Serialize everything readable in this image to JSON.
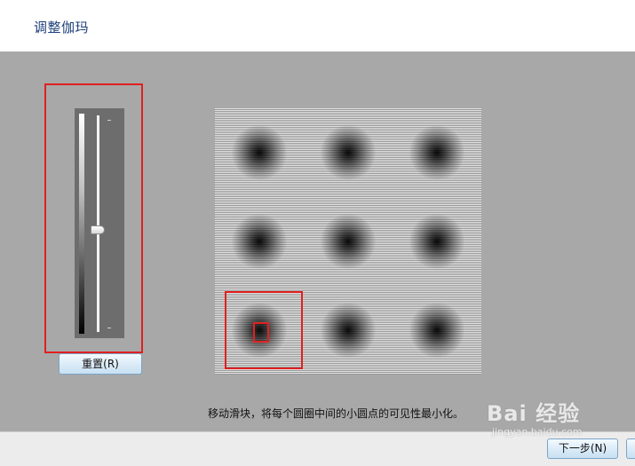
{
  "window": {
    "title": "调整伽玛"
  },
  "slider": {
    "orientation": "vertical",
    "position_fraction_from_top": 0.53
  },
  "buttons": {
    "reset_label": "重置(R)",
    "next_label": "下一步(N)"
  },
  "pattern": {
    "rows": 3,
    "cols": 3
  },
  "instruction": "移动滑块，将每个圆圈中间的小圆点的可见性最小化。",
  "watermark": {
    "logo_text": "Bai  经验",
    "url": "jingyan.baidu.com"
  },
  "colors": {
    "title": "#1e3f7a",
    "content_bg": "#a8a8a8",
    "highlight": "#e02020"
  }
}
